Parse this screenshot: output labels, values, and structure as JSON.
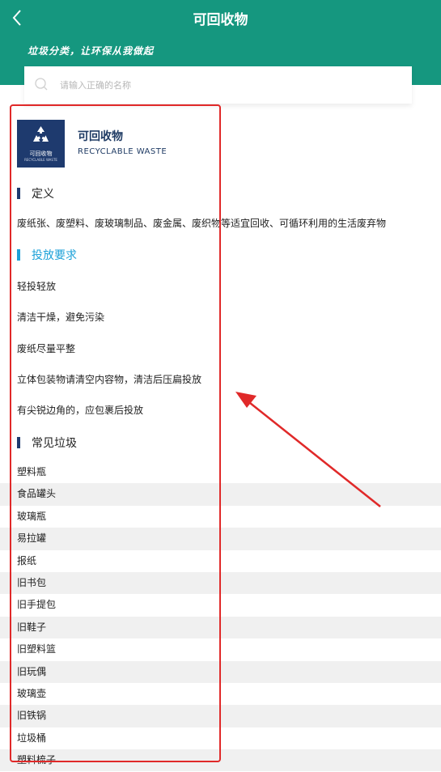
{
  "header": {
    "title": "可回收物",
    "slogan": "垃圾分类，让环保从我做起"
  },
  "search": {
    "placeholder": "请输入正确的名称"
  },
  "category": {
    "name_cn": "可回收物",
    "name_en": "RECYCLABLE WASTE",
    "logo_cn": "可回收物",
    "logo_en": "RECYCLABLE WASTE",
    "logo_color": "#1e3a6e"
  },
  "sections": {
    "definition_title": "定义",
    "definition_text": "废纸张、废塑料、废玻璃制品、废金属、废织物等适宜回收、可循环利用的生活废弃物",
    "requirements_title": "投放要求",
    "requirements": [
      "轻投轻放",
      "清洁干燥，避免污染",
      "废纸尽量平整",
      "立体包装物请清空内容物，清洁后压扁投放",
      "有尖锐边角的，应包裹后投放"
    ],
    "common_title": "常见垃圾",
    "common_items": [
      "塑料瓶",
      "食品罐头",
      "玻璃瓶",
      "易拉罐",
      "报纸",
      "旧书包",
      "旧手提包",
      "旧鞋子",
      "旧塑料篮",
      "旧玩偶",
      "玻璃壶",
      "旧铁锅",
      "垃圾桶",
      "塑料梳子"
    ]
  },
  "colors": {
    "header": "#15977f",
    "accent_blue": "#1da1d8",
    "annotation_red": "#e02929"
  }
}
